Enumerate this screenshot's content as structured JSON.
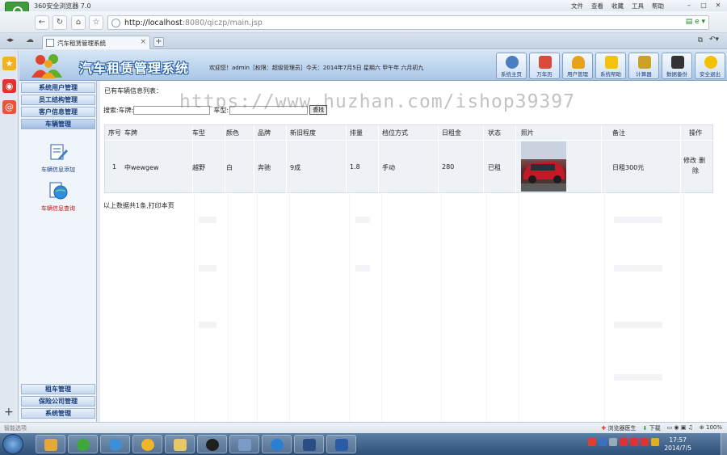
{
  "browser": {
    "app_title": "360安全浏览器 7.0",
    "menu": [
      "文件",
      "查看",
      "收藏",
      "工具",
      "帮助"
    ],
    "address": {
      "host": "http://localhost",
      "path": ":8080/qiczp/main.jsp"
    },
    "tab_title": "汽车租赁管理系统"
  },
  "header": {
    "system_title": "汽车租赁管理系统",
    "welcome": "欢迎您！admin［权限：超级管理员］今天：2014年7月5日 星期六 甲午年 六月初九",
    "buttons": [
      {
        "label": "系统主页",
        "icon": "clock-icon",
        "color": "#4a7fc1"
      },
      {
        "label": "万年历",
        "icon": "calendar-icon",
        "color": "#d94b3a"
      },
      {
        "label": "用户管理",
        "icon": "user-icon",
        "color": "#e8a020"
      },
      {
        "label": "系统帮助",
        "icon": "help-icon",
        "color": "#f4c20d"
      },
      {
        "label": "计算器",
        "icon": "calculator-icon",
        "color": "#c9a227"
      },
      {
        "label": "数据备份",
        "icon": "floppy-icon",
        "color": "#333333"
      },
      {
        "label": "安全退出",
        "icon": "power-icon",
        "color": "#f2c100"
      }
    ]
  },
  "sidebar": {
    "top_items": [
      "系统用户管理",
      "员工结构管理",
      "客户信息管理",
      "车辆管理"
    ],
    "sub_items": [
      "车辆信息添加",
      "车辆信息查询"
    ],
    "bottom_items": [
      "租车管理",
      "保险公司管理",
      "系统管理"
    ]
  },
  "content": {
    "list_title": "已有车辆信息列表：",
    "search_brand_label": "搜索:车牌:",
    "search_type_label": "车型:",
    "search_button": "查找",
    "columns": [
      "序号",
      "车牌",
      "车型",
      "颜色",
      "品牌",
      "新旧程度",
      "排量",
      "档位方式",
      "日租金",
      "状态",
      "照片",
      "备注",
      "操作"
    ],
    "row": {
      "index": "1",
      "plate": "中wewgew",
      "model": "越野",
      "color": "白",
      "brand": "奔驰",
      "condition": "9成",
      "displacement": "1.8",
      "gear": "手动",
      "daily_rent": "280",
      "status": "已租",
      "remark": "日租300元",
      "op_edit": "修改",
      "op_delete": "删除"
    },
    "summary": "以上数据共1条,打印本页"
  },
  "watermark": "https://www.huzhan.com/ishop39397",
  "statusbar": {
    "left": "智能选项",
    "doctor": "浏览器医生",
    "download": "下载",
    "zoom": "100%"
  },
  "taskbar": {
    "time": "17:57",
    "date": "2014/7/5"
  }
}
